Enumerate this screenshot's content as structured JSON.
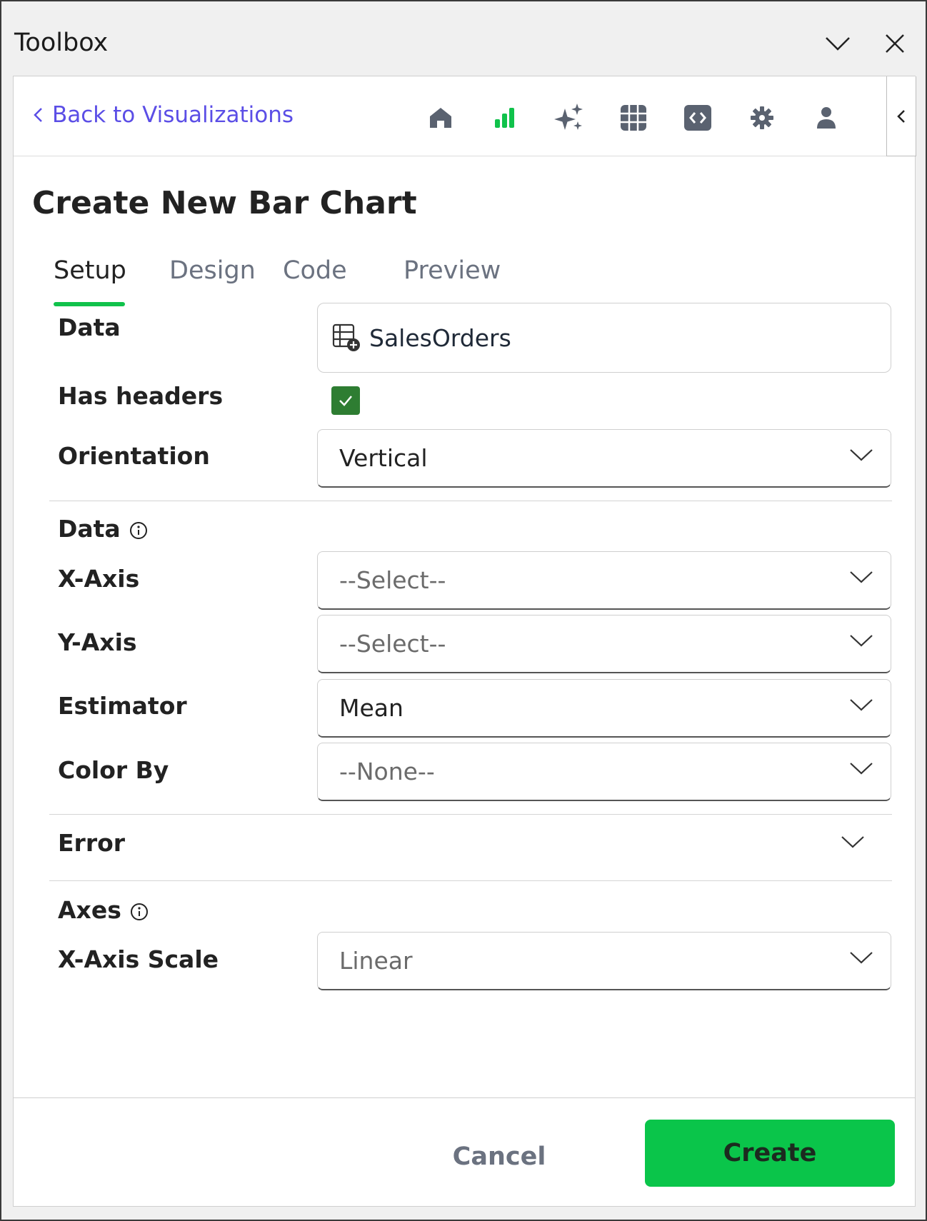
{
  "window": {
    "title": "Toolbox"
  },
  "navbar": {
    "back_label": "Back to Visualizations",
    "icons": [
      "home-icon",
      "bar-chart-icon",
      "sparkles-icon",
      "grid-icon",
      "code-icon",
      "gear-icon",
      "user-icon"
    ],
    "accent_color": "#5b4ee6",
    "active_icon_color": "#10c24b"
  },
  "page": {
    "heading": "Create New Bar Chart"
  },
  "tabs": [
    {
      "label": "Setup",
      "active": true
    },
    {
      "label": "Design",
      "active": false
    },
    {
      "label": "Code",
      "active": false
    },
    {
      "label": "Preview",
      "active": false
    }
  ],
  "form": {
    "data_label": "Data",
    "data_value": "SalesOrders",
    "has_headers_label": "Has headers",
    "has_headers_checked": true,
    "orientation_label": "Orientation",
    "orientation_value": "Vertical",
    "data_section_label": "Data",
    "x_axis_label": "X-Axis",
    "x_axis_value": "--Select--",
    "y_axis_label": "Y-Axis",
    "y_axis_value": "--Select--",
    "estimator_label": "Estimator",
    "estimator_value": "Mean",
    "color_by_label": "Color By",
    "color_by_value": "--None--",
    "error_section_label": "Error",
    "axes_section_label": "Axes",
    "x_axis_scale_label": "X-Axis Scale",
    "x_axis_scale_value": "Linear"
  },
  "footer": {
    "cancel_label": "Cancel",
    "create_label": "Create",
    "create_color": "#0ac54a"
  }
}
